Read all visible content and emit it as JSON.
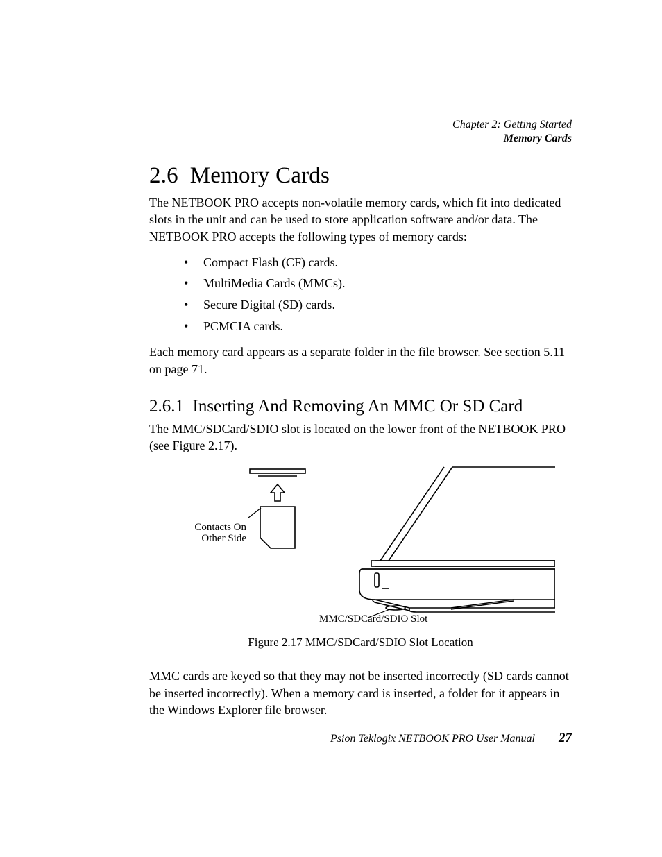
{
  "header": {
    "line1": "Chapter 2:  Getting Started",
    "line2": "Memory Cards"
  },
  "section": {
    "number": "2.6",
    "title": "Memory Cards",
    "intro": "The NETBOOK PRO accepts non-volatile memory cards, which fit into dedicated slots in the unit and can be used to store application software and/or data. The NETBOOK PRO accepts the following types of memory cards:",
    "bullets": [
      "Compact Flash (CF) cards.",
      "MultiMedia Cards (MMCs).",
      "Secure Digital (SD) cards.",
      "PCMCIA cards."
    ],
    "after_list": "Each memory card appears as a separate folder in the file browser. See section 5.11 on page 71."
  },
  "subsection": {
    "number": "2.6.1",
    "title": "Inserting And Removing An MMC Or SD Card",
    "p1": "The MMC/SDCard/SDIO slot is located on the lower front of the NETBOOK PRO (see Figure 2.17).",
    "figure": {
      "contacts_label_l1": "Contacts On",
      "contacts_label_l2": "Other Side",
      "slot_label": "MMC/SDCard/SDIO Slot",
      "caption": "Figure 2.17 MMC/SDCard/SDIO Slot Location"
    },
    "p2": "MMC cards are keyed so that they may not be inserted incorrectly (SD cards cannot be inserted incorrectly). When a memory card is inserted, a folder for it appears in the Windows Explorer file browser."
  },
  "footer": {
    "text": "Psion Teklogix NETBOOK PRO User Manual",
    "page": "27"
  }
}
